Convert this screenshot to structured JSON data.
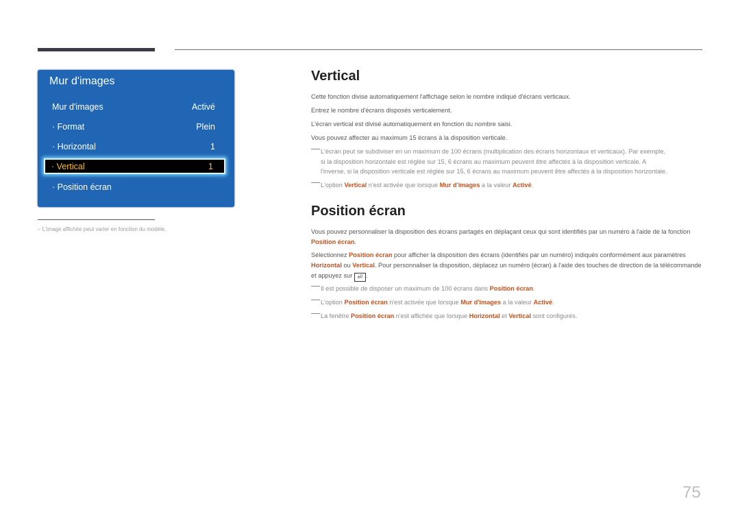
{
  "osd": {
    "title": "Mur d'images",
    "rows": [
      {
        "label": "Mur d'images",
        "value": "Activé"
      },
      {
        "label": "· Format",
        "value": "Plein"
      },
      {
        "label": "· Horizontal",
        "value": "1"
      },
      {
        "label": "· Vertical",
        "value": "1",
        "selected": true
      },
      {
        "label": "· Position écran",
        "value": ""
      }
    ]
  },
  "footnote": "–  L'image affichée peut varier en fonction du modèle.",
  "section1": {
    "title": "Vertical",
    "paragraphs": [
      "Cette fonction divise automatiquement l'affichage selon le nombre indiqué d'écrans verticaux.",
      "Entrez le nombre d'écrans disposés verticalement.",
      "L'écran vertical est divisé automatiquement en fonction du nombre saisi.",
      "Vous pouvez affecter au maximum 15 écrans à la disposition verticale."
    ],
    "note1": {
      "line1": "L'écran peut se subdiviser en un maximum de 100 écrans (multiplication des écrans horizontaux et verticaux). Par exemple,",
      "line2": "si la disposition horizontale est réglée sur 15, 6 écrans au maximum peuvent être affectés à la disposition verticale. A",
      "line3": "l'inverse, si la disposition verticale est réglée sur 15, 6 écrans au maximum peuvent être affectés à la disposition horizontale."
    },
    "note2": {
      "t1": "L'option ",
      "h1": "Vertical",
      "t2": " n'est activée que lorsque ",
      "h2": "Mur d'images",
      "t3": " a la valeur ",
      "h3": "Activé",
      "t4": "."
    }
  },
  "section2": {
    "title": "Position écran",
    "p1": {
      "t1": "Vous pouvez personnaliser la disposition des écrans partagés en déplaçant ceux qui sont identifiés par un numéro à l'aide de la fonction ",
      "h1": "Position écran",
      "t2": "."
    },
    "p2": {
      "t1": "Sélectionnez ",
      "h1": "Position écran",
      "t2": " pour afficher la disposition des écrans (identifiés par un numéro) indiqués conformément aux paramètres ",
      "h2": "Horizontal",
      "t3": " ou ",
      "h3": "Vertical",
      "t4": ". Pour personnaliser la disposition, déplacez un numéro (écran) à l'aide des touches de direction de la télécommande et appuyez sur ",
      "icon": "⏎",
      "t5": "."
    },
    "note1": {
      "t1": "Il est possible de disposer un maximum de 100 écrans dans ",
      "h1": "Position écran",
      "t2": "."
    },
    "note2": {
      "t1": "L'option ",
      "h1": "Position écran",
      "t2": " n'est activée que lorsque ",
      "h2": "Mur d'images",
      "t3": " a la valeur ",
      "h3": "Activé",
      "t4": "."
    },
    "note3": {
      "t1": "La fenêtre ",
      "h1": "Position écran",
      "t2": " n'est affichée que lorsque ",
      "h2": "Horizontal",
      "t3": " et ",
      "h3": "Vertical",
      "t4": " sont configurés."
    }
  },
  "page_number": "75"
}
